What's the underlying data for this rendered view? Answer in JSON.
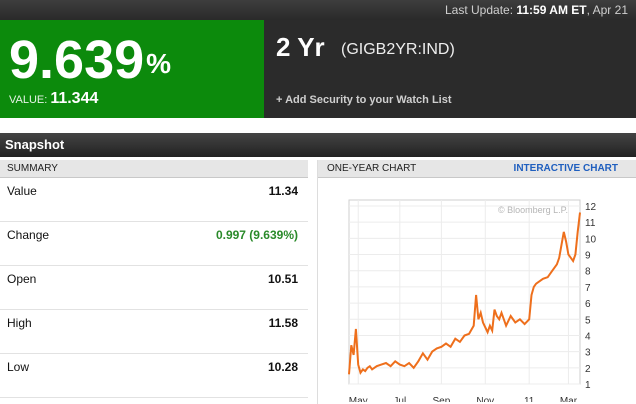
{
  "top": {
    "label": "Last Update:",
    "time": "11:59 AM ET",
    "date": ", Apr 21"
  },
  "hero": {
    "big_value": "9.639",
    "big_unit": "%",
    "value_label": "VALUE:",
    "value": "11.344",
    "name": "2 Yr",
    "code": "(GIGB2YR:IND)",
    "watch": "+ Add Security to your Watch List",
    "accent": "#0c8a0c"
  },
  "snapshot": {
    "title": "Snapshot"
  },
  "summary": {
    "header": "SUMMARY",
    "rows": [
      {
        "label": "Value",
        "value": "11.34"
      },
      {
        "label": "Change",
        "value": "0.997 (9.639%)"
      },
      {
        "label": "Open",
        "value": "10.51"
      },
      {
        "label": "High",
        "value": "11.58"
      },
      {
        "label": "Low",
        "value": "10.28"
      }
    ]
  },
  "chart": {
    "header": "ONE-YEAR CHART",
    "interactive": "INTERACTIVE CHART",
    "watermark": "© Bloomberg L.P."
  },
  "chart_data": {
    "type": "line",
    "title": "",
    "xlabel": "",
    "ylabel": "",
    "ylim": [
      1,
      12
    ],
    "y_ticks": [
      1,
      2,
      3,
      4,
      5,
      6,
      7,
      8,
      9,
      10,
      11,
      12
    ],
    "x_ticks": [
      "May",
      "Jul",
      "Sep",
      "Nov",
      "11",
      "Mar"
    ],
    "x_tick_pos": [
      0.04,
      0.22,
      0.4,
      0.59,
      0.78,
      0.95
    ],
    "series": [
      {
        "color": "#ee6f1c",
        "x": [
          0.0,
          0.01,
          0.02,
          0.03,
          0.04,
          0.05,
          0.06,
          0.07,
          0.08,
          0.09,
          0.1,
          0.12,
          0.14,
          0.16,
          0.18,
          0.2,
          0.22,
          0.24,
          0.26,
          0.28,
          0.3,
          0.32,
          0.34,
          0.36,
          0.38,
          0.4,
          0.42,
          0.44,
          0.46,
          0.48,
          0.5,
          0.52,
          0.54,
          0.55,
          0.56,
          0.57,
          0.58,
          0.6,
          0.61,
          0.62,
          0.63,
          0.64,
          0.65,
          0.66,
          0.68,
          0.7,
          0.72,
          0.74,
          0.76,
          0.78,
          0.79,
          0.8,
          0.81,
          0.82,
          0.84,
          0.86,
          0.88,
          0.9,
          0.91,
          0.92,
          0.93,
          0.94,
          0.95,
          0.96,
          0.97,
          0.98,
          0.99,
          1.0
        ],
        "values": [
          1.6,
          3.4,
          2.8,
          4.4,
          2.2,
          1.7,
          1.9,
          1.8,
          2.0,
          2.1,
          1.9,
          2.1,
          2.2,
          2.3,
          2.1,
          2.4,
          2.2,
          2.1,
          2.3,
          2.0,
          2.4,
          2.9,
          2.5,
          3.0,
          3.2,
          3.3,
          3.5,
          3.3,
          3.8,
          3.6,
          4.0,
          4.1,
          4.6,
          6.5,
          5.0,
          5.4,
          4.8,
          4.2,
          4.6,
          4.3,
          5.6,
          5.2,
          5.0,
          5.4,
          4.6,
          5.2,
          4.8,
          5.0,
          4.7,
          5.0,
          6.5,
          7.0,
          7.2,
          7.3,
          7.5,
          7.6,
          8.0,
          8.4,
          8.8,
          9.6,
          10.4,
          9.8,
          9.0,
          8.8,
          8.6,
          9.0,
          10.4,
          11.6
        ]
      }
    ]
  }
}
